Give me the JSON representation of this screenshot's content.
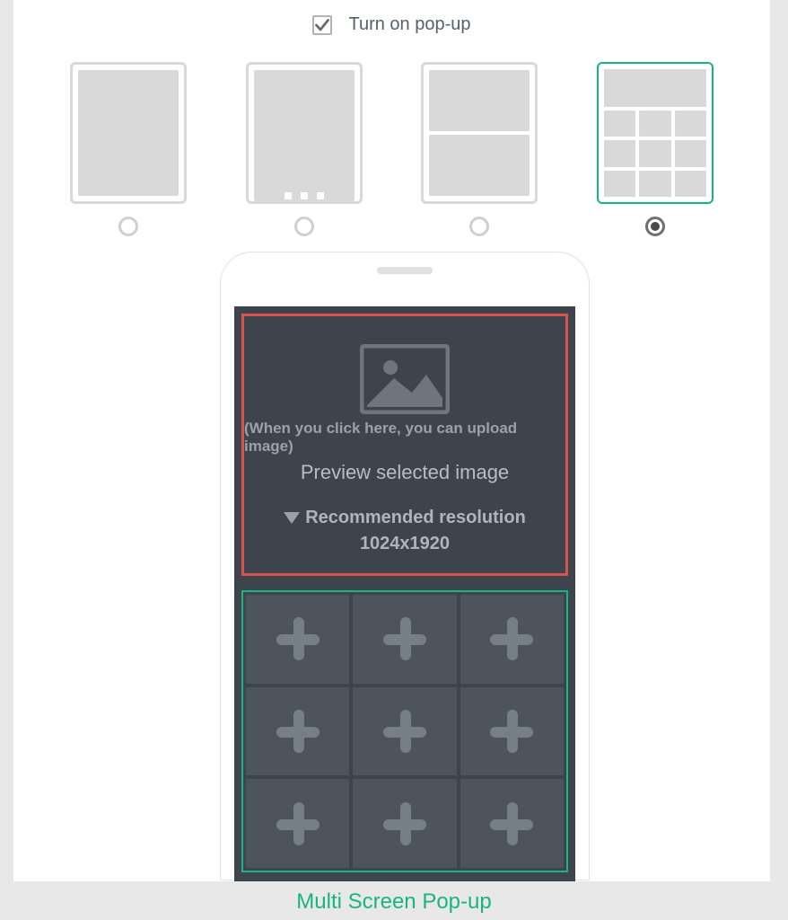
{
  "colors": {
    "accent": "#18b581",
    "alert": "#d9534f",
    "panel_dark": "#3d444c"
  },
  "header": {
    "checkbox_checked": true,
    "checkbox_label": "Turn on pop-up"
  },
  "layouts": {
    "options": [
      "single",
      "slideshow",
      "two-panel",
      "grid"
    ],
    "selected_index": 3
  },
  "upload_hero": {
    "hint": "(When you click here, you can upload image)",
    "preview_text": "Preview selected image",
    "recommended_label": "Recommended resolution",
    "recommended_value": "1024x1920"
  },
  "grid": {
    "slot_count": 9,
    "icon": "plus-icon"
  },
  "caption": "Multi Screen Pop-up"
}
